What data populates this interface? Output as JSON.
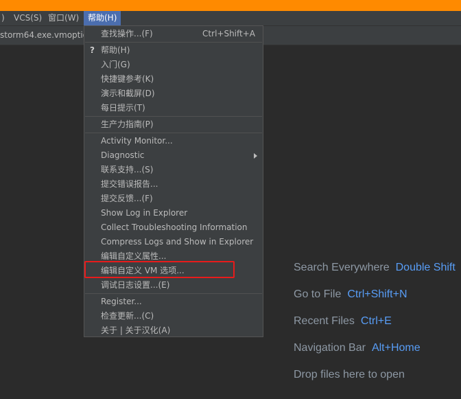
{
  "menubar": {
    "items": [
      {
        "label": ")"
      },
      {
        "label": "VCS(S)"
      },
      {
        "label": "窗口(W)"
      },
      {
        "label": "帮助(H)"
      }
    ]
  },
  "editor_tab": {
    "label": "storm64.exe.vmoption"
  },
  "help_menu": {
    "find_action": {
      "label": "查找操作...(F)",
      "shortcut": "Ctrl+Shift+A"
    },
    "help": {
      "label": "帮助(H)",
      "icon": "question-mark-icon"
    },
    "getting_started": {
      "label": "入门(G)"
    },
    "keymap_reference": {
      "label": "快捷键参考(K)"
    },
    "demos_screencasts": {
      "label": "演示和截屏(D)"
    },
    "tip_of_the_day": {
      "label": "每日提示(T)"
    },
    "productivity_guide": {
      "label": "生产力指南(P)"
    },
    "activity_monitor": {
      "label": "Activity Monitor..."
    },
    "diagnostic": {
      "label": "Diagnostic"
    },
    "contact_support": {
      "label": "联系支持...(S)"
    },
    "submit_bug_report": {
      "label": "提交错误报告..."
    },
    "submit_feedback": {
      "label": "提交反馈...(F)"
    },
    "show_log": {
      "label": "Show Log in Explorer"
    },
    "collect_troubleshooting": {
      "label": "Collect Troubleshooting Information"
    },
    "compress_logs": {
      "label": "Compress Logs and Show in Explorer"
    },
    "edit_custom_properties": {
      "label": "编辑自定义属性..."
    },
    "edit_custom_vm_options": {
      "label": "编辑自定义 VM 选项..."
    },
    "debug_log_settings": {
      "label": "调试日志设置...(E)"
    },
    "register": {
      "label": "Register..."
    },
    "check_updates": {
      "label": "检查更新...(C)"
    },
    "about": {
      "label": "关于 | 关于汉化(A)"
    }
  },
  "welcome_hints": [
    {
      "label": "Search Everywhere",
      "shortcut": "Double Shift"
    },
    {
      "label": "Go to File",
      "shortcut": "Ctrl+Shift+N"
    },
    {
      "label": "Recent Files",
      "shortcut": "Ctrl+E"
    },
    {
      "label": "Navigation Bar",
      "shortcut": "Alt+Home"
    },
    {
      "label": "Drop files here to open",
      "shortcut": ""
    }
  ],
  "colors": {
    "window_bg": "#2b2b2b",
    "menu_bg": "#3c3f41",
    "menu_active": "#4b6eaf",
    "title_accent": "#fe8a00",
    "shortcut_blue": "#589df6",
    "highlight_red": "#e81b1b"
  }
}
